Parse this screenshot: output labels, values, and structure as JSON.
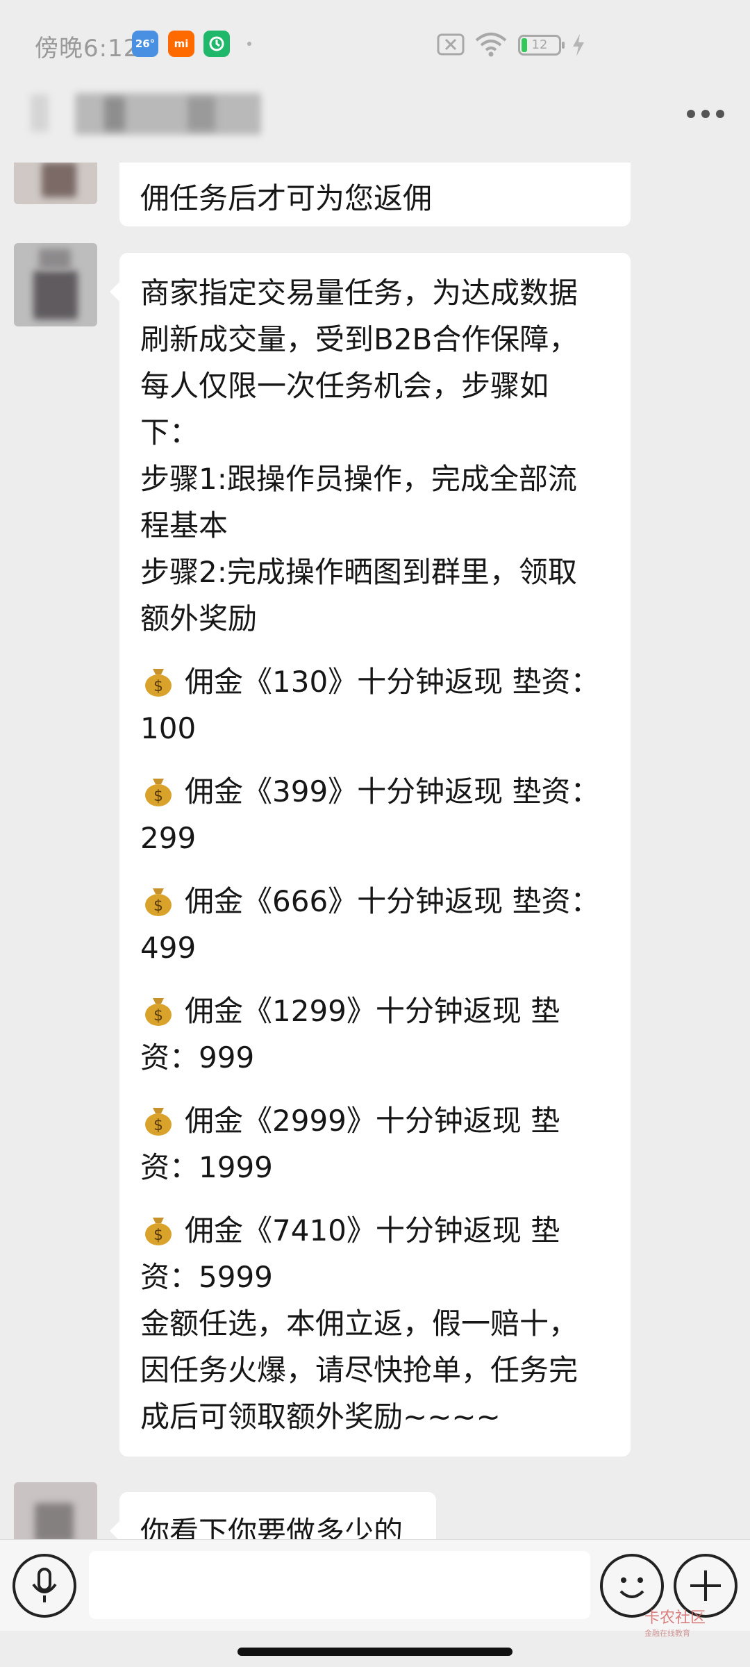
{
  "status_bar": {
    "time": "傍晚6:12",
    "apps": [
      "26°",
      "mi",
      ""
    ],
    "battery_level": "12"
  },
  "header": {
    "more_icon": "more-dots-icon"
  },
  "messages": {
    "m1": {
      "text": "佣任务后才可为您返佣"
    },
    "m2": {
      "intro": [
        "商家指定交易量任务，为达成数据",
        "刷新成交量，受到B2B合作保障，",
        "每人仅限一次任务机会，步骤如",
        "下："
      ],
      "steps": [
        "步骤1:跟操作员操作，完成全部流",
        "程基本",
        "步骤2:完成操作晒图到群里，领取",
        "额外奖励"
      ],
      "commissions": [
        {
          "line1": "佣金《130》十分钟返现 垫资：",
          "line2": "100"
        },
        {
          "line1": "佣金《399》十分钟返现 垫资：",
          "line2": "299"
        },
        {
          "line1": "佣金《666》十分钟返现 垫资：",
          "line2": "499"
        },
        {
          "line1": "佣金《1299》十分钟返现 垫",
          "line2": "资：999"
        },
        {
          "line1": "佣金《2999》十分钟返现 垫",
          "line2": "资：1999"
        },
        {
          "line1": "佣金《7410》十分钟返现 垫",
          "line2": "资：5999"
        }
      ],
      "outro": [
        "金额任选，本佣立返，假一赔十，",
        "因任务火爆，请尽快抢单，任务完",
        "成后可领取额外奖励~~~~"
      ]
    },
    "m3": {
      "text": "你看下你要做多少的"
    }
  },
  "input_bar": {
    "voice_icon": "microphone-icon",
    "emoji_icon": "smiley-icon",
    "add_icon": "plus-icon",
    "watermark": "卡农社区",
    "watermark_sub": "金融在线教育"
  },
  "colors": {
    "background": "#ededed",
    "bubble": "#ffffff",
    "bag_gold": "#d9a32b"
  }
}
